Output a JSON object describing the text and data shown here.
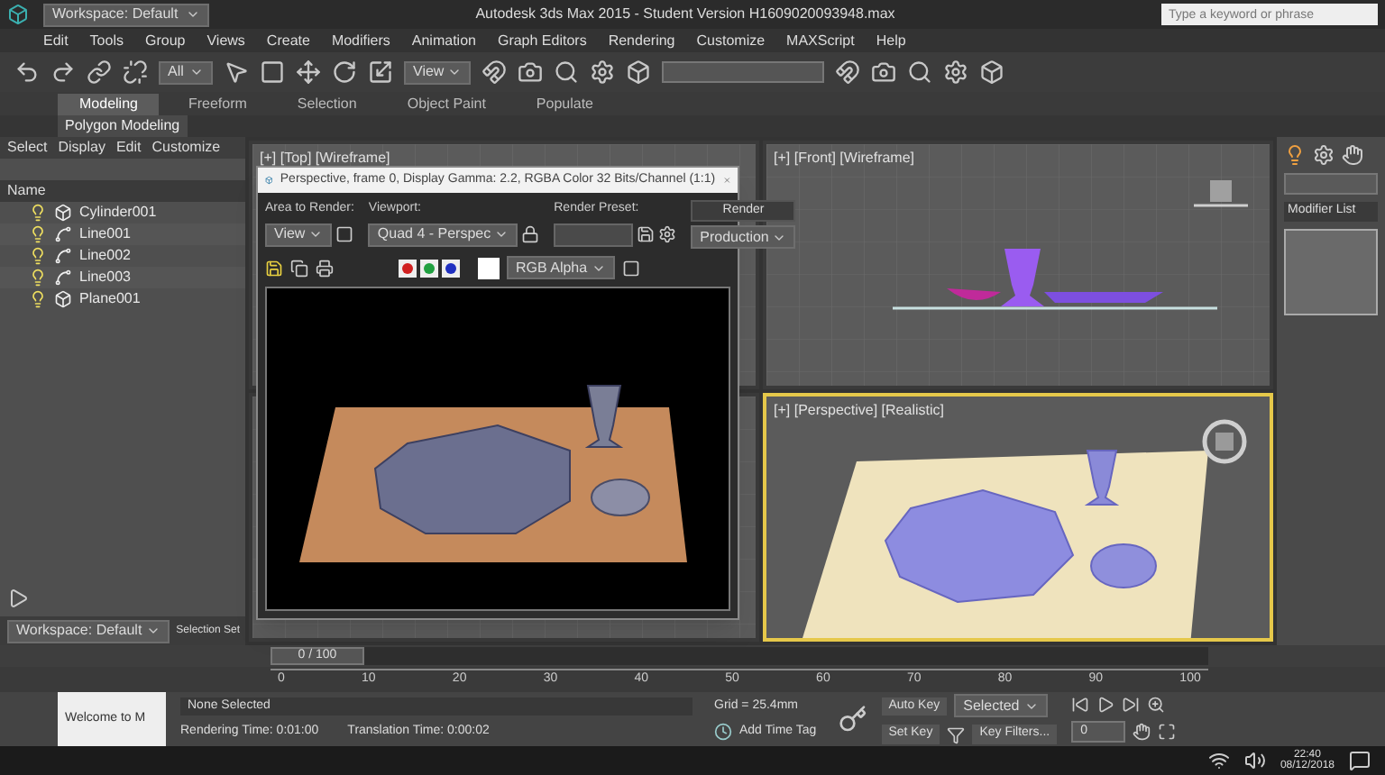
{
  "title_bar": {
    "workspace": "Workspace: Default",
    "title": "Autodesk 3ds Max 2015 - Student Version   H1609020093948.max",
    "search_placeholder": "Type a keyword or phrase"
  },
  "menu": [
    "Edit",
    "Tools",
    "Group",
    "Views",
    "Create",
    "Modifiers",
    "Animation",
    "Graph Editors",
    "Rendering",
    "Customize",
    "MAXScript",
    "Help"
  ],
  "toolbar": {
    "selection_filter": "All",
    "reference_coord": "View"
  },
  "ribbon": {
    "tabs": [
      {
        "label": "Modeling",
        "selected": true
      },
      {
        "label": "Freeform",
        "selected": false
      },
      {
        "label": "Selection",
        "selected": false
      },
      {
        "label": "Object Paint",
        "selected": false
      },
      {
        "label": "Populate",
        "selected": false
      }
    ],
    "panel": "Polygon Modeling"
  },
  "scene_explorer": {
    "menu": [
      "Select",
      "Display",
      "Edit",
      "Customize"
    ],
    "column": "Name",
    "items": [
      {
        "name": "Cylinder001",
        "kind": "geometry"
      },
      {
        "name": "Line001",
        "kind": "shape"
      },
      {
        "name": "Line002",
        "kind": "shape"
      },
      {
        "name": "Line003",
        "kind": "shape"
      },
      {
        "name": "Plane001",
        "kind": "geometry"
      }
    ],
    "workspace": "Workspace: Default",
    "selection_set": "Selection Set"
  },
  "viewports": [
    {
      "label": "[+] [Top] [Wireframe]",
      "kind": "top",
      "active": false
    },
    {
      "label": "[+] [Front] [Wireframe]",
      "kind": "front",
      "active": false
    },
    {
      "kind": "left",
      "active": false
    },
    {
      "label": "[+] [Perspective] [Realistic]",
      "kind": "perspective",
      "active": true
    }
  ],
  "render_window": {
    "title": "Perspective, frame 0, Display Gamma: 2.2, RGBA Color 32 Bits/Channel (1:1)",
    "area_label": "Area to Render:",
    "area_value": "View",
    "viewport_label": "Viewport:",
    "viewport_value": "Quad 4 - Perspec",
    "preset_label": "Render Preset:",
    "render_button": "Render",
    "render_mode": "Production",
    "channel_display": "RGB Alpha"
  },
  "command_panel": {
    "modifier_list": "Modifier List"
  },
  "timeline": {
    "frame": "0 / 100",
    "level": 0,
    "ticks": [
      "0",
      "10",
      "20",
      "30",
      "40",
      "50",
      "60",
      "70",
      "80",
      "90",
      "100"
    ]
  },
  "status": {
    "maxscript": "Welcome to M",
    "selection": "None Selected",
    "rendering_time": "Rendering Time: 0:01:00",
    "translation_time": "Translation Time: 0:00:02",
    "grid": "Grid = 25.4mm",
    "add_time_tag": "Add Time Tag",
    "auto_key": "Auto Key",
    "key_mode": "Selected",
    "set_key": "Set Key",
    "key_filters": "Key Filters...",
    "current_frame": "0"
  },
  "taskbar": {
    "time": "22:40",
    "date": "08/12/2018"
  }
}
